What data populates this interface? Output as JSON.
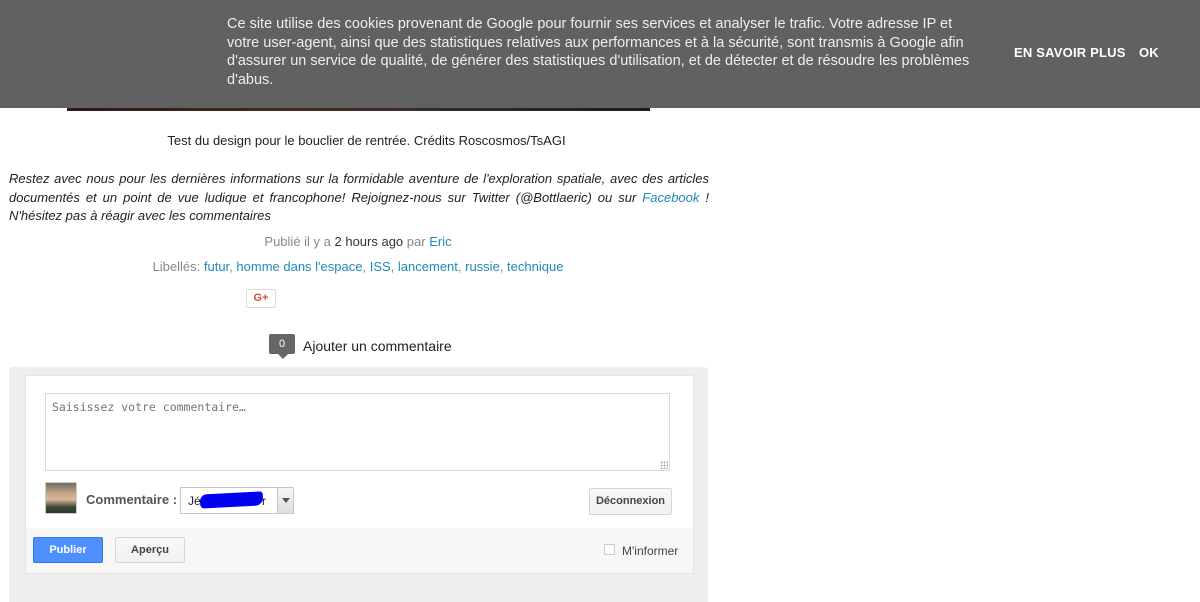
{
  "cookie_banner": {
    "message": "Ce site utilise des cookies provenant de Google pour fournir ses services et analyser le trafic. Votre adresse IP et votre user-agent, ainsi que des statistiques relatives aux performances et à la sécurité, sont transmis à Google afin d'assurer un service de qualité, de générer des statistiques d'utilisation, et de détecter et de résoudre les problèmes d'abus.",
    "learn_more": "EN SAVOIR PLUS",
    "ok": "OK"
  },
  "post": {
    "caption": "Test du design pour le bouclier de rentrée. Crédits Roscosmos/TsAGI",
    "blurb_text": "Restez avec nous pour les dernières informations sur la formidable aventure de l'exploration spatiale, avec des articles documentés et un point de vue ludique et francophone! Rejoignez-nous sur Twitter (@Bottlaeric) ou sur ",
    "blurb_link": "Facebook",
    "blurb_end": " ! N'hésitez pas à réagir avec les commentaires",
    "published_prefix": "Publié il y a ",
    "published_time": "2 hours ago",
    "published_by": " par ",
    "author": "Eric",
    "labels_prefix": "Libellés: ",
    "labels": [
      "futur",
      "homme dans l'espace",
      "ISS",
      "lancement",
      "russie",
      "technique"
    ],
    "gplus_label": "G+"
  },
  "comments": {
    "count": "0",
    "add_label": "Ajouter un commentaire",
    "textarea_placeholder": "Saisissez votre commentaire…",
    "commenter_label": "Commentaire :",
    "identity_prefix": "Jé",
    "identity_suffix": "r",
    "logout_label": "Déconnexion",
    "publish_label": "Publier",
    "preview_label": "Aperçu",
    "notify_label": "M'informer"
  },
  "colors": {
    "banner_bg": "#616161",
    "link": "#2288bb",
    "publish_button": "#4d90fe",
    "redaction": "#0000f0"
  }
}
